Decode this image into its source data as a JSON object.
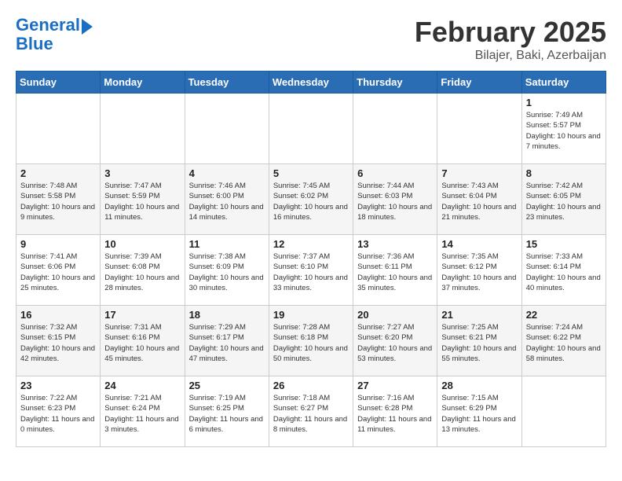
{
  "logo": {
    "line1": "General",
    "line2": "Blue"
  },
  "title": "February 2025",
  "subtitle": "Bilajer, Baki, Azerbaijan",
  "weekdays": [
    "Sunday",
    "Monday",
    "Tuesday",
    "Wednesday",
    "Thursday",
    "Friday",
    "Saturday"
  ],
  "weeks": [
    [
      {
        "day": "",
        "info": ""
      },
      {
        "day": "",
        "info": ""
      },
      {
        "day": "",
        "info": ""
      },
      {
        "day": "",
        "info": ""
      },
      {
        "day": "",
        "info": ""
      },
      {
        "day": "",
        "info": ""
      },
      {
        "day": "1",
        "info": "Sunrise: 7:49 AM\nSunset: 5:57 PM\nDaylight: 10 hours and 7 minutes."
      }
    ],
    [
      {
        "day": "2",
        "info": "Sunrise: 7:48 AM\nSunset: 5:58 PM\nDaylight: 10 hours and 9 minutes."
      },
      {
        "day": "3",
        "info": "Sunrise: 7:47 AM\nSunset: 5:59 PM\nDaylight: 10 hours and 11 minutes."
      },
      {
        "day": "4",
        "info": "Sunrise: 7:46 AM\nSunset: 6:00 PM\nDaylight: 10 hours and 14 minutes."
      },
      {
        "day": "5",
        "info": "Sunrise: 7:45 AM\nSunset: 6:02 PM\nDaylight: 10 hours and 16 minutes."
      },
      {
        "day": "6",
        "info": "Sunrise: 7:44 AM\nSunset: 6:03 PM\nDaylight: 10 hours and 18 minutes."
      },
      {
        "day": "7",
        "info": "Sunrise: 7:43 AM\nSunset: 6:04 PM\nDaylight: 10 hours and 21 minutes."
      },
      {
        "day": "8",
        "info": "Sunrise: 7:42 AM\nSunset: 6:05 PM\nDaylight: 10 hours and 23 minutes."
      }
    ],
    [
      {
        "day": "9",
        "info": "Sunrise: 7:41 AM\nSunset: 6:06 PM\nDaylight: 10 hours and 25 minutes."
      },
      {
        "day": "10",
        "info": "Sunrise: 7:39 AM\nSunset: 6:08 PM\nDaylight: 10 hours and 28 minutes."
      },
      {
        "day": "11",
        "info": "Sunrise: 7:38 AM\nSunset: 6:09 PM\nDaylight: 10 hours and 30 minutes."
      },
      {
        "day": "12",
        "info": "Sunrise: 7:37 AM\nSunset: 6:10 PM\nDaylight: 10 hours and 33 minutes."
      },
      {
        "day": "13",
        "info": "Sunrise: 7:36 AM\nSunset: 6:11 PM\nDaylight: 10 hours and 35 minutes."
      },
      {
        "day": "14",
        "info": "Sunrise: 7:35 AM\nSunset: 6:12 PM\nDaylight: 10 hours and 37 minutes."
      },
      {
        "day": "15",
        "info": "Sunrise: 7:33 AM\nSunset: 6:14 PM\nDaylight: 10 hours and 40 minutes."
      }
    ],
    [
      {
        "day": "16",
        "info": "Sunrise: 7:32 AM\nSunset: 6:15 PM\nDaylight: 10 hours and 42 minutes."
      },
      {
        "day": "17",
        "info": "Sunrise: 7:31 AM\nSunset: 6:16 PM\nDaylight: 10 hours and 45 minutes."
      },
      {
        "day": "18",
        "info": "Sunrise: 7:29 AM\nSunset: 6:17 PM\nDaylight: 10 hours and 47 minutes."
      },
      {
        "day": "19",
        "info": "Sunrise: 7:28 AM\nSunset: 6:18 PM\nDaylight: 10 hours and 50 minutes."
      },
      {
        "day": "20",
        "info": "Sunrise: 7:27 AM\nSunset: 6:20 PM\nDaylight: 10 hours and 53 minutes."
      },
      {
        "day": "21",
        "info": "Sunrise: 7:25 AM\nSunset: 6:21 PM\nDaylight: 10 hours and 55 minutes."
      },
      {
        "day": "22",
        "info": "Sunrise: 7:24 AM\nSunset: 6:22 PM\nDaylight: 10 hours and 58 minutes."
      }
    ],
    [
      {
        "day": "23",
        "info": "Sunrise: 7:22 AM\nSunset: 6:23 PM\nDaylight: 11 hours and 0 minutes."
      },
      {
        "day": "24",
        "info": "Sunrise: 7:21 AM\nSunset: 6:24 PM\nDaylight: 11 hours and 3 minutes."
      },
      {
        "day": "25",
        "info": "Sunrise: 7:19 AM\nSunset: 6:25 PM\nDaylight: 11 hours and 6 minutes."
      },
      {
        "day": "26",
        "info": "Sunrise: 7:18 AM\nSunset: 6:27 PM\nDaylight: 11 hours and 8 minutes."
      },
      {
        "day": "27",
        "info": "Sunrise: 7:16 AM\nSunset: 6:28 PM\nDaylight: 11 hours and 11 minutes."
      },
      {
        "day": "28",
        "info": "Sunrise: 7:15 AM\nSunset: 6:29 PM\nDaylight: 11 hours and 13 minutes."
      },
      {
        "day": "",
        "info": ""
      }
    ]
  ]
}
